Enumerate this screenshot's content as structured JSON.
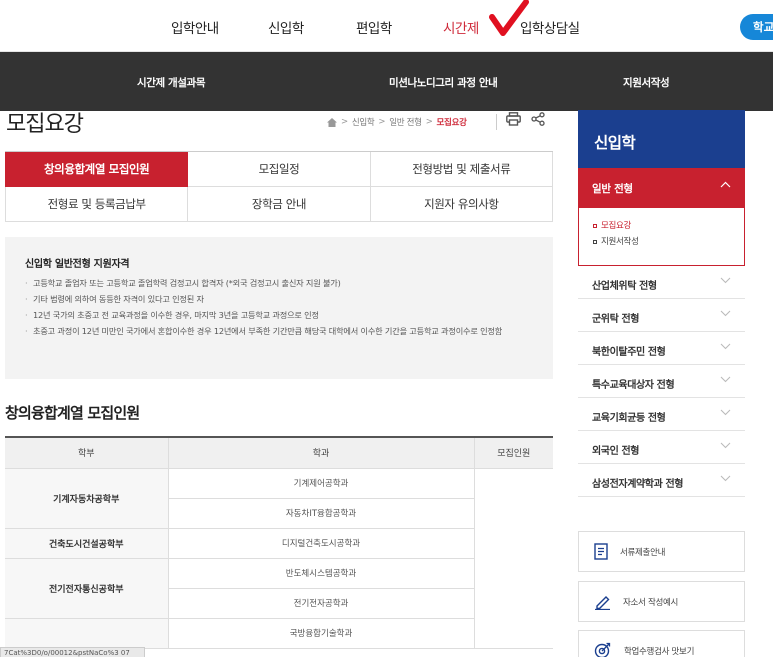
{
  "topnav": {
    "menus": [
      "입학안내",
      "신입학",
      "편입학",
      "시간제",
      "입학상담실"
    ],
    "active_index": 3,
    "right_button": "학교",
    "accent": "#cf2a3a",
    "button_color": "#1687d8"
  },
  "subnav": {
    "items": [
      "시간제 개설과목",
      "미션나노디그리 과정 안내",
      "지원서작성"
    ]
  },
  "page": {
    "title": "모집요강",
    "breadcrumb": [
      "신입학",
      "일반 전형",
      "모집요강"
    ],
    "icons": [
      "home-icon",
      "print-icon",
      "share-icon"
    ]
  },
  "tabs": {
    "row1": [
      "창의융합계열 모집인원",
      "모집일정",
      "전형방법 및 제출서류"
    ],
    "row2": [
      "전형료 및 등록금납부",
      "장학금 안내",
      "지원자 유의사항"
    ],
    "active": "창의융합계열 모집인원"
  },
  "info": {
    "title": "신입학 일반전형 지원자격",
    "items": [
      "고등학교 졸업자 또는 고등학교 졸업학력 검정고시 합격자 (*외국 검정고시 출신자 지원 불가)",
      "기타 법령에 의하여 동등한 자격이 있다고 인정된 자",
      "12년 국가의 초중고 전 교육과정을 이수한 경우, 마지막 3년을 고등학교 과정으로 인정",
      "초중고 과정이 12년 미만인 국가에서 혼합이수한 경우 12년에서 부족한 기간만큼 해당국 대학에서 이수한 기간을 고등학교 과정이수로 인정함"
    ]
  },
  "section": {
    "title": "창의융합계열 모집인원"
  },
  "table": {
    "headers": [
      "학부",
      "학과",
      "모집인원"
    ],
    "rows": [
      {
        "dept": "기계자동차공학부",
        "majors": [
          "기계제어공학과",
          "자동차IT융합공학과"
        ]
      },
      {
        "dept": "건축도시건설공학부",
        "majors": [
          "디지털건축도시공학과"
        ]
      },
      {
        "dept": "전기전자통신공학부",
        "majors": [
          "반도체시스템공학과",
          "전기전자공학과"
        ]
      },
      {
        "dept": "",
        "majors": [
          "국방융합기술학과"
        ]
      }
    ]
  },
  "status_url": "7Cat%3D0/o/00012&pstNaCo%3 07",
  "sidebar": {
    "title": "신입학",
    "active": "일반 전형",
    "sub_items": [
      "모집요강",
      "지원서작성"
    ],
    "items": [
      "산업체위탁 전형",
      "군위탁 전형",
      "북한이탈주민 전형",
      "특수교육대상자 전형",
      "교육기회균등 전형",
      "외국인 전형",
      "삼성전자계약학과 전형"
    ],
    "head_color": "#1b3f8f",
    "active_color": "#c8212f"
  },
  "quick": [
    "서류제출안내",
    "자소서 작성예시",
    "학업수행검사 맛보기"
  ]
}
